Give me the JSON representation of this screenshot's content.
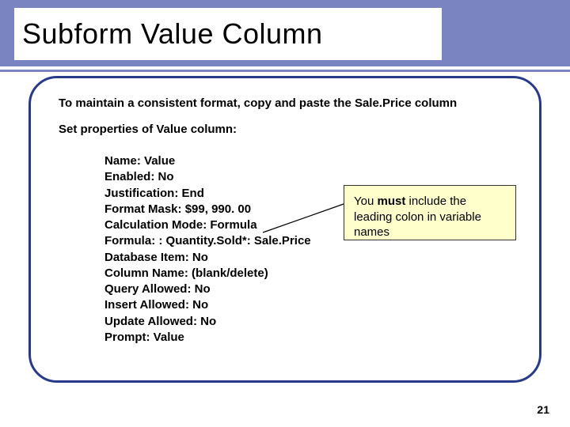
{
  "title": "Subform Value Column",
  "intro": "To maintain a consistent format, copy and paste the Sale.Price column",
  "subintro": "Set properties of Value column:",
  "properties": [
    {
      "label": "Name",
      "value": "Value"
    },
    {
      "label": "Enabled",
      "value": "No"
    },
    {
      "label": "Justification",
      "value": "End"
    },
    {
      "label": "Format Mask",
      "value": "$99, 990. 00"
    },
    {
      "label": "Calculation Mode",
      "value": "Formula"
    },
    {
      "label": "Formula",
      "value": ": Quantity.Sold*: Sale.Price"
    },
    {
      "label": "Database Item",
      "value": "No"
    },
    {
      "label": "Column Name",
      "value": "(blank/delete)"
    },
    {
      "label": "Query Allowed",
      "value": "No"
    },
    {
      "label": "Insert Allowed",
      "value": "No"
    },
    {
      "label": "Update Allowed",
      "value": "No"
    },
    {
      "label": "Prompt",
      "value": "Value"
    }
  ],
  "callout": {
    "pre": "You ",
    "bold": "must",
    "post": " include the leading colon in variable names"
  },
  "pageNumber": "21"
}
